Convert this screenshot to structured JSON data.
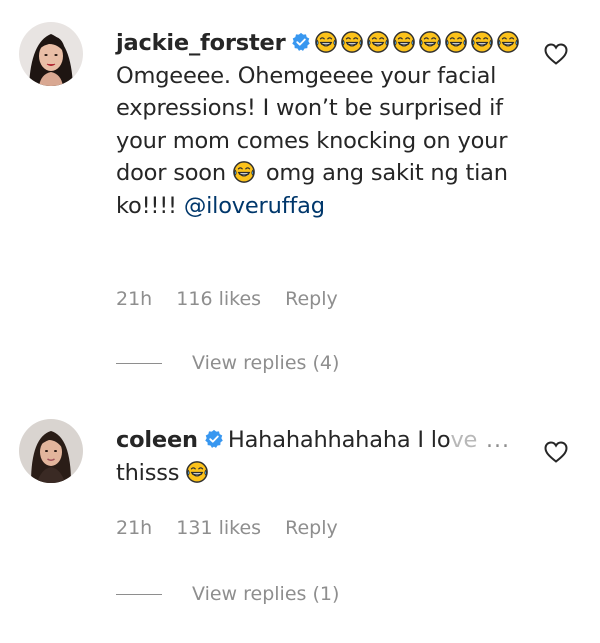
{
  "comments": [
    {
      "username": "jackie_forster",
      "verified": true,
      "text_part1": "Omgeeee. Ohemgeeee your facial expressions! I won’t be surprised if your mom comes knocking on your door soon",
      "text_part2": "omg ang sakit ng tian ko!!!!",
      "mention": "@iloveruffag",
      "emoji_icon": "tears-of-joy-emoji",
      "time": "21h",
      "likes": "116 likes",
      "reply_label": "Reply",
      "view_replies": "View replies (4)"
    },
    {
      "username": "coleen",
      "verified": true,
      "text_visible": "Hahahahhahaha I lo",
      "text_faded": "ve",
      "more_label": "...",
      "text_line2": "thisss",
      "emoji_icon": "tears-of-joy-emoji",
      "time": "21h",
      "likes": "131 likes",
      "reply_label": "Reply",
      "view_replies": "View replies (1)"
    }
  ],
  "colors": {
    "text": "#262626",
    "secondary": "#8e8e8e",
    "mention": "#00376b",
    "verified_badge": "#3897f0",
    "emoji_face": "#fcc21b",
    "emoji_tears": "#4fb3f6"
  },
  "icons": {
    "like": "heart-outline-icon",
    "verified": "verified-badge-icon"
  }
}
